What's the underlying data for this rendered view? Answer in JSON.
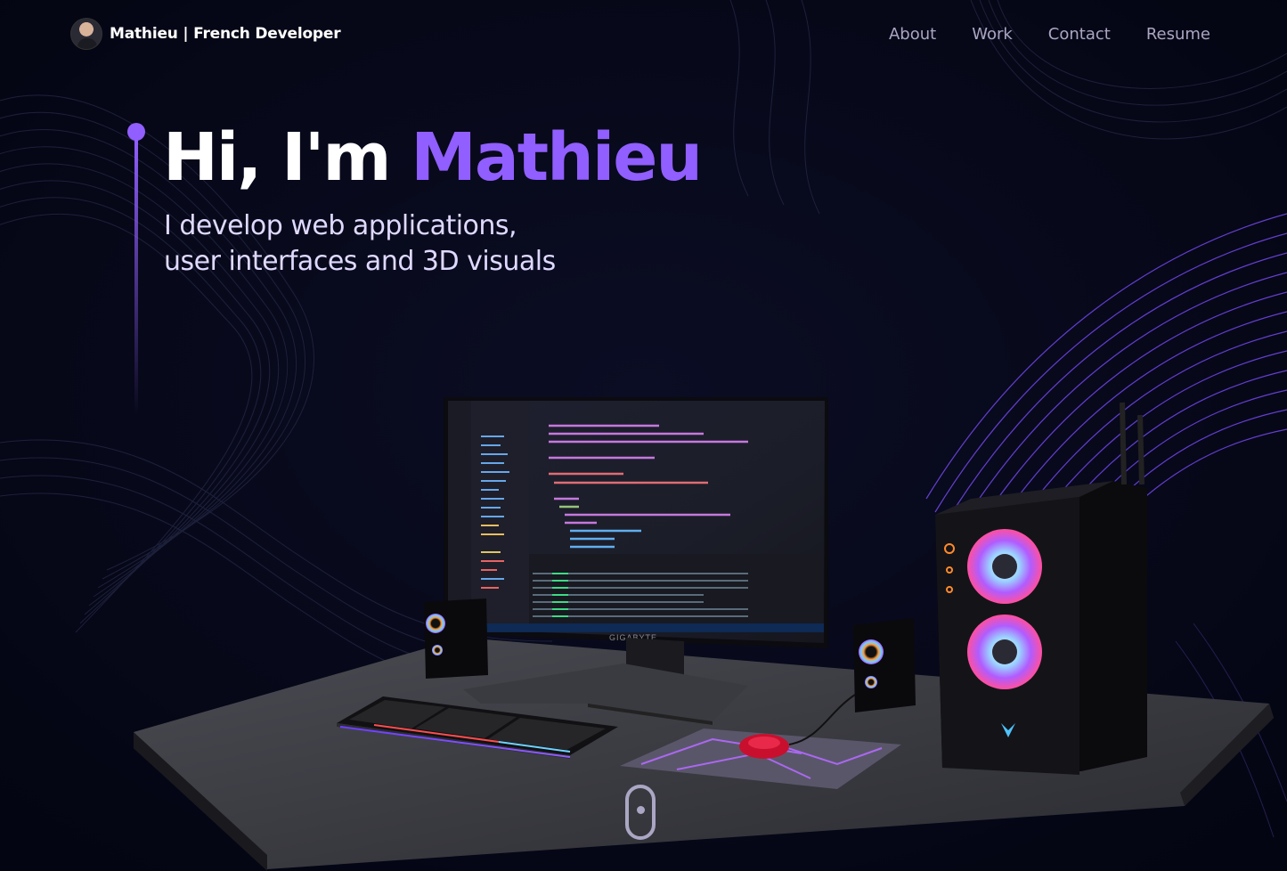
{
  "nav": {
    "brand_name": "Mathieu | French Developer",
    "links": [
      "About",
      "Work",
      "Contact",
      "Resume"
    ]
  },
  "hero": {
    "greeting": "Hi, I'm ",
    "name": "Mathieu",
    "subtitle_line1": "I develop web applications,",
    "subtitle_line2": "user interfaces and 3D visuals"
  },
  "scene": {
    "monitor_brand": "GIGABYTE"
  },
  "colors": {
    "background": "#060816",
    "accent": "#915eff",
    "nav_link": "#aaa6c3"
  },
  "icons": [
    "avatar-image",
    "scroll-indicator-icon"
  ]
}
